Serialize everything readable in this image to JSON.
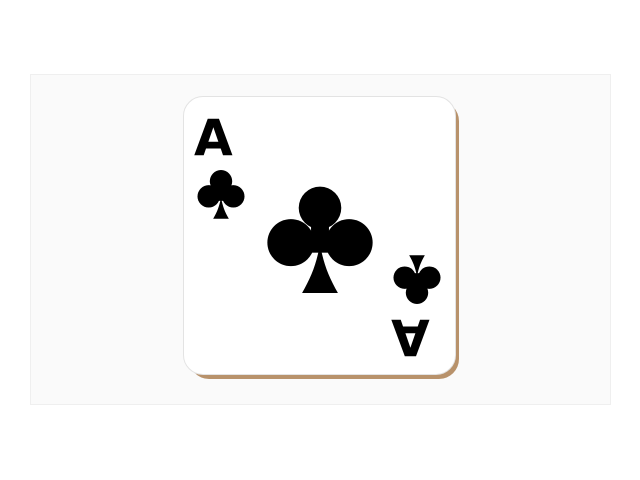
{
  "card": {
    "rank": "A",
    "suit": "clubs",
    "suit_icon": "club-icon",
    "colors": {
      "background": "#ffffff",
      "panel": "#fafafa",
      "card_face": "#ffffff",
      "card_shadow": "#b8926b",
      "ink": "#000000"
    }
  }
}
